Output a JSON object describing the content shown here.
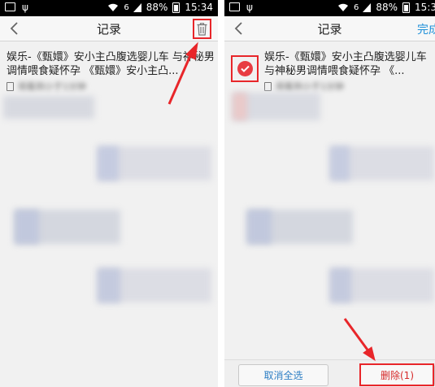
{
  "left": {
    "status": {
      "battery": "88%",
      "time": "15:34",
      "signal_label": "6"
    },
    "topbar": {
      "title": "记录"
    },
    "record": {
      "title": "娱乐-《甄嬛》安小主凸腹选婴儿车 与神秘男调情喂食疑怀孕 《甄嬛》安小主凸...",
      "meta": "观看到小于1分钟"
    }
  },
  "right": {
    "status": {
      "battery": "88%",
      "time": "15:3",
      "signal_label": "6"
    },
    "topbar": {
      "title": "记录",
      "done_label": "完成"
    },
    "record": {
      "title": "娱乐-《甄嬛》安小主凸腹选婴儿车与神秘男调情喂食疑怀孕 《...",
      "meta": "观看到小于1分钟"
    },
    "bottom": {
      "cancel_select_label": "取消全选",
      "delete_label": "删除(1)"
    }
  },
  "colors": {
    "accent_blue": "#1d8fd9",
    "highlight_red": "#e8262a",
    "check_red": "#e83c42"
  }
}
